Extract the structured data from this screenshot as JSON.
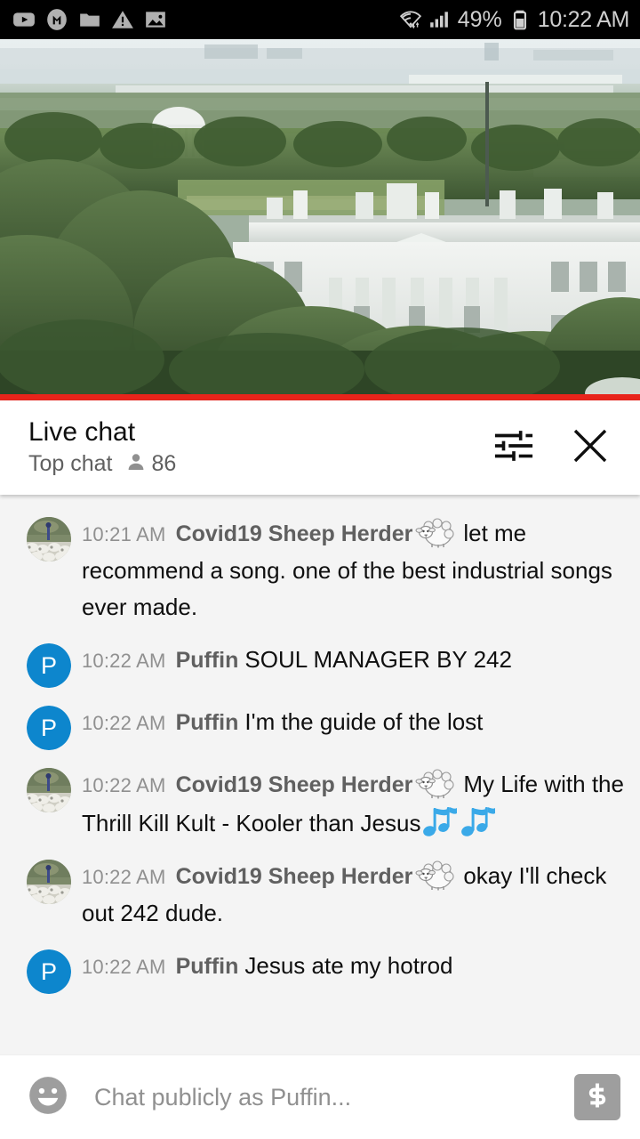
{
  "status_bar": {
    "icons": [
      "youtube-icon",
      "m-circle-icon",
      "folder-icon",
      "warning-triangle-icon",
      "image-icon"
    ],
    "wifi_icon": "wifi-icon",
    "signal_icon": "cellular-signal-icon",
    "battery_percent": "49%",
    "battery_icon": "battery-icon",
    "time": "10:22 AM"
  },
  "video": {
    "description": "White House live webcam view with Jefferson Memorial in background",
    "progress_percent": 100,
    "progress_color": "#e8241b"
  },
  "chat_header": {
    "title": "Live chat",
    "subtitle": "Top chat",
    "viewer_count": "86",
    "viewer_icon": "person-icon",
    "settings_icon": "tune-sliders-icon",
    "close_icon": "close-x-icon"
  },
  "messages": [
    {
      "time": "10:21 AM",
      "author": "Covid19 Sheep Herder",
      "badge": "sheep-emoji",
      "text": "let me recommend a song. one of the best industrial songs ever made.",
      "avatar_type": "photo",
      "avatar_label": "shepherd-with-sheep-photo",
      "trailing_emoji": ""
    },
    {
      "time": "10:22 AM",
      "author": "Puffin",
      "badge": "",
      "text": "SOUL MANAGER BY 242",
      "avatar_type": "initial",
      "avatar_label": "P",
      "avatar_color": "#0d86cd",
      "trailing_emoji": ""
    },
    {
      "time": "10:22 AM",
      "author": "Puffin",
      "badge": "",
      "text": "I'm the guide of the lost",
      "avatar_type": "initial",
      "avatar_label": "P",
      "avatar_color": "#0d86cd",
      "trailing_emoji": ""
    },
    {
      "time": "10:22 AM",
      "author": "Covid19 Sheep Herder",
      "badge": "sheep-emoji",
      "text": "My Life with the Thrill Kill Kult - Kooler than Jesus",
      "avatar_type": "photo",
      "avatar_label": "shepherd-with-sheep-photo",
      "trailing_emoji": "musical-notes-emoji-x2"
    },
    {
      "time": "10:22 AM",
      "author": "Covid19 Sheep Herder",
      "badge": "sheep-emoji",
      "text": "okay I'll check out 242 dude.",
      "avatar_type": "photo",
      "avatar_label": "shepherd-with-sheep-photo",
      "trailing_emoji": ""
    },
    {
      "time": "10:22 AM",
      "author": "Puffin",
      "badge": "",
      "text": "Jesus ate my hotrod",
      "avatar_type": "initial",
      "avatar_label": "P",
      "avatar_color": "#0d86cd",
      "trailing_emoji": ""
    }
  ],
  "composer": {
    "emoji_icon": "emoji-smiley-icon",
    "placeholder": "Chat publicly as Puffin...",
    "value": "",
    "superchat_icon": "dollar-sign-icon"
  }
}
